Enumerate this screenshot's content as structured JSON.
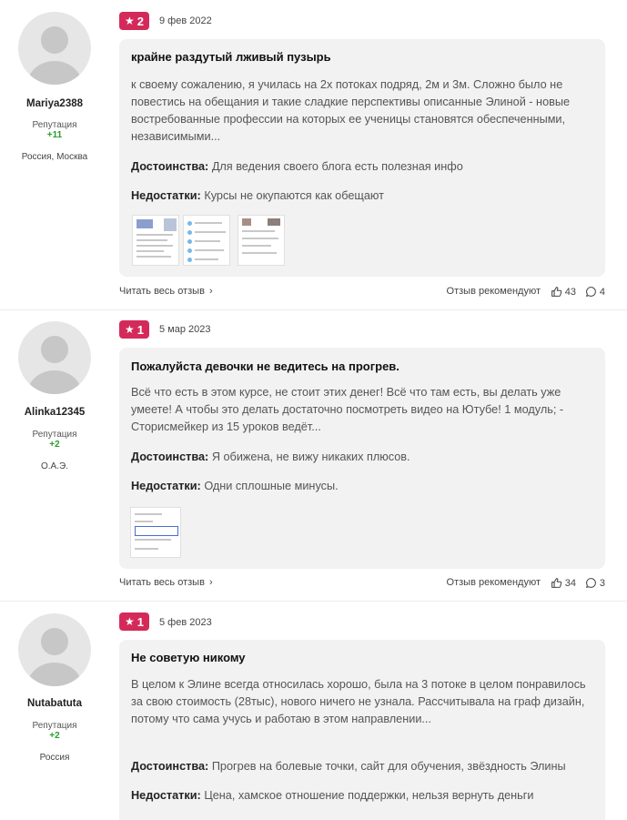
{
  "reviews": [
    {
      "author": {
        "nick": "Mariya2388",
        "rep_label": "Репутация",
        "rep_value": "+11",
        "city": "Россия, Москва"
      },
      "rating": "2",
      "date": "9 фев 2022",
      "title": "крайне раздутый лживый пузырь",
      "body": "к своему сожалению, я училась на 2х потоках подряд, 2м и 3м. Сложно было не повестись на обещания и такие сладкие перспективы описанные Элиной - новые востребованные профессии на которых ее ученицы становятся обеспеченными, независимыми...",
      "pros_label": "Достоинства:",
      "pros": "Для ведения своего блога есть полезная инфо",
      "cons_label": "Недостатки:",
      "cons": "Курсы не окупаются как обещают",
      "read_more": "Читать весь отзыв",
      "recommend": "Отзыв рекомендуют",
      "likes": "43",
      "comments": "4"
    },
    {
      "author": {
        "nick": "Alinka12345",
        "rep_label": "Репутация",
        "rep_value": "+2",
        "city": "О.А.Э."
      },
      "rating": "1",
      "date": "5 мар 2023",
      "title": "Пожалуйста девочки не ведитесь на прогрев.",
      "body": "Всё что есть в этом курсе, не стоит этих денег! Всё что там есть, вы делать уже умеете! А чтобы это делать достаточно посмотреть видео на Ютубе! 1 модуль; - Сторисмейкер из 15 уроков ведёт...",
      "pros_label": "Достоинства:",
      "pros": "Я обижена, не вижу никаких плюсов.",
      "cons_label": "Недостатки:",
      "cons": "Одни сплошные минусы.",
      "read_more": "Читать весь отзыв",
      "recommend": "Отзыв рекомендуют",
      "likes": "34",
      "comments": "3"
    },
    {
      "author": {
        "nick": "Nutabatuta",
        "rep_label": "Репутация",
        "rep_value": "+2",
        "city": "Россия"
      },
      "rating": "1",
      "date": "5 фев 2023",
      "title": "Не советую никому",
      "body": "В целом к Элине всегда относилась хорошо, была на 3 потоке в целом понравилось за свою стоимость (28тыс), нового ничего не узнала. Рассчитывала на граф дизайн, потому что сама учусь и работаю в этом направлении...",
      "pros_label": "Достоинства:",
      "pros": "Прогрев на болевые точки, сайт для обучения, звёздность Элины",
      "cons_label": "Недостатки:",
      "cons": "Цена, хамское отношение поддержки, нельзя вернуть деньги"
    }
  ],
  "icons": {
    "rating": "star-icon",
    "like": "thumbs-up-icon",
    "comment": "comment-icon",
    "chevron": "chevron-right-icon"
  },
  "colors": {
    "rating_badge": "#d42a5a",
    "reputation": "#2a9d2a",
    "card_bg": "#f2f2f2"
  }
}
